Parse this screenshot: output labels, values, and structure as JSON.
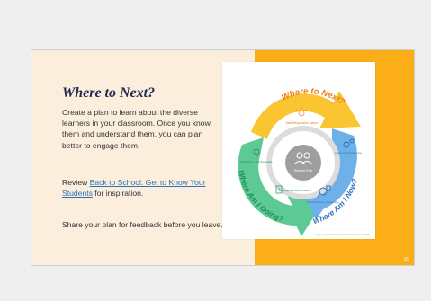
{
  "slide": {
    "title": "Where to Next?",
    "intro": "Create a plan to learn about the diverse learners in your classroom. Once you know them and understand them, you can plan better to engage them.",
    "review_prefix": "Review ",
    "review_link": "Back to School: Get to Know Your Students",
    "review_suffix": " for inspiration.",
    "share": "Share your plan for feedback before you leave.",
    "page_number": "16"
  },
  "diagram": {
    "where_to_next": "Where to Next?",
    "where_am_i_going": "Where Am I Going?",
    "where_am_i_now": "Where Am I Now?",
    "center_label": "Student Role",
    "step_next": "Take Responsive Action",
    "step_goals": "Determine Learning Goals",
    "step_criteria": "Develop Success Criteria",
    "step_evidence": "Elicit Evidence of Learning",
    "step_interpret": "Interpret the Evidence",
    "credit": "Image adapted from Heritage, 2010; Chappuis, 2015"
  },
  "colors": {
    "yellow_arrow": "#fbc531",
    "green_arrow": "#5dc995",
    "blue_arrow": "#6eb0e8",
    "orange_text": "#ee7c1c",
    "blue_text": "#2f70bb",
    "green_text": "#1f8d5a"
  }
}
